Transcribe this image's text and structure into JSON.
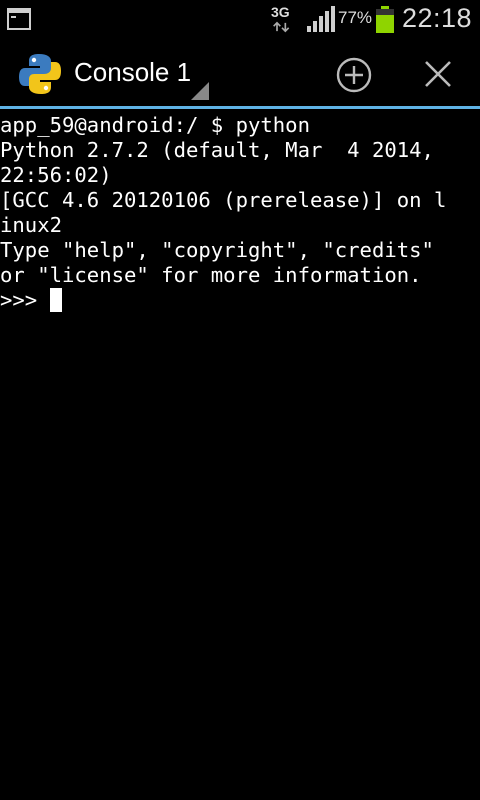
{
  "status_bar": {
    "network_type": "3G",
    "battery_percent": "77%",
    "battery_level": 0.77,
    "time": "22:18",
    "battery_color": "#8fd400"
  },
  "action_bar": {
    "title": "Console 1",
    "accent_color": "#5fb3e6"
  },
  "terminal": {
    "lines": [
      "app_59@android:/ $ python",
      "Python 2.7.2 (default, Mar  4 2014,",
      "22:56:02)",
      "[GCC 4.6 20120106 (prerelease)] on l",
      "inux2",
      "Type \"help\", \"copyright\", \"credits\"",
      "or \"license\" for more information."
    ],
    "prompt": ">>> "
  }
}
